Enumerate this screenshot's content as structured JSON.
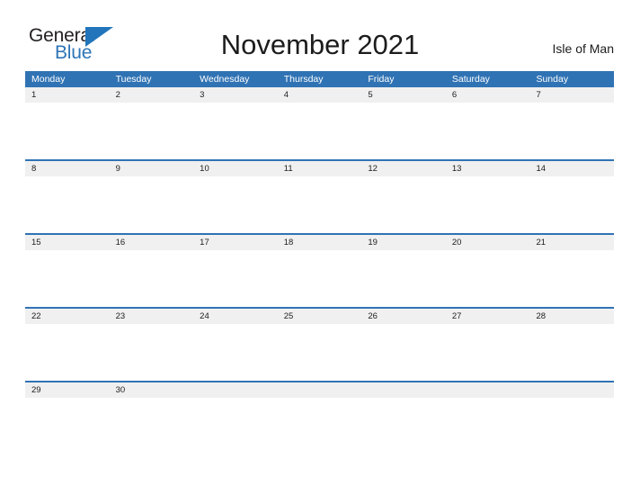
{
  "brand": {
    "name_part1": "General",
    "name_part2": "Blue",
    "flag_icon": "blue-triangle-flag",
    "accent_color": "#2e75b6"
  },
  "header": {
    "title": "November 2021",
    "location": "Isle of Man"
  },
  "calendar": {
    "month": "November",
    "year": "2021",
    "header_color": "#3073b4",
    "band_color": "#f0f0f0",
    "weekdays": [
      "Monday",
      "Tuesday",
      "Wednesday",
      "Thursday",
      "Friday",
      "Saturday",
      "Sunday"
    ],
    "weeks": [
      [
        "1",
        "2",
        "3",
        "4",
        "5",
        "6",
        "7"
      ],
      [
        "8",
        "9",
        "10",
        "11",
        "12",
        "13",
        "14"
      ],
      [
        "15",
        "16",
        "17",
        "18",
        "19",
        "20",
        "21"
      ],
      [
        "22",
        "23",
        "24",
        "25",
        "26",
        "27",
        "28"
      ],
      [
        "29",
        "30",
        "",
        "",
        "",
        "",
        ""
      ]
    ]
  }
}
